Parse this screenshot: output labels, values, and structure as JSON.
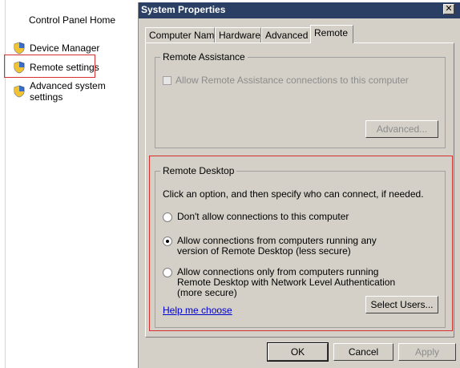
{
  "sidebar": {
    "home": "Control Panel Home",
    "items": [
      {
        "label": "Device Manager",
        "icon": "shield-icon"
      },
      {
        "label": "Remote settings",
        "icon": "shield-icon"
      },
      {
        "label": "Advanced system settings",
        "icon": "shield-icon"
      }
    ]
  },
  "dialog": {
    "title": "System Properties",
    "close": "✕",
    "tabs": [
      "Computer Name",
      "Hardware",
      "Advanced",
      "Remote"
    ],
    "active_tab": "Remote"
  },
  "remote_assistance": {
    "legend": "Remote Assistance",
    "checkbox_label": "Allow Remote Assistance connections to this computer",
    "checked": false,
    "advanced_button": "Advanced..."
  },
  "remote_desktop": {
    "legend": "Remote Desktop",
    "instruction": "Click an option, and then specify who can connect, if needed.",
    "options": [
      "Don't allow connections to this computer",
      "Allow connections from computers running any version of Remote Desktop (less secure)",
      "Allow connections only from computers running Remote Desktop with Network Level Authentication (more secure)"
    ],
    "selected_option": "Allow connections from computers running any version of Remote Desktop (less secure)",
    "help_link": "Help me choose",
    "select_users_button": "Select Users..."
  },
  "footer": {
    "ok": "OK",
    "cancel": "Cancel",
    "apply": "Apply"
  },
  "colors": {
    "titlebar": "#2a3f63",
    "dialog_bg": "#d4d0c8",
    "highlight": "#d63030",
    "link": "#0000cc"
  }
}
